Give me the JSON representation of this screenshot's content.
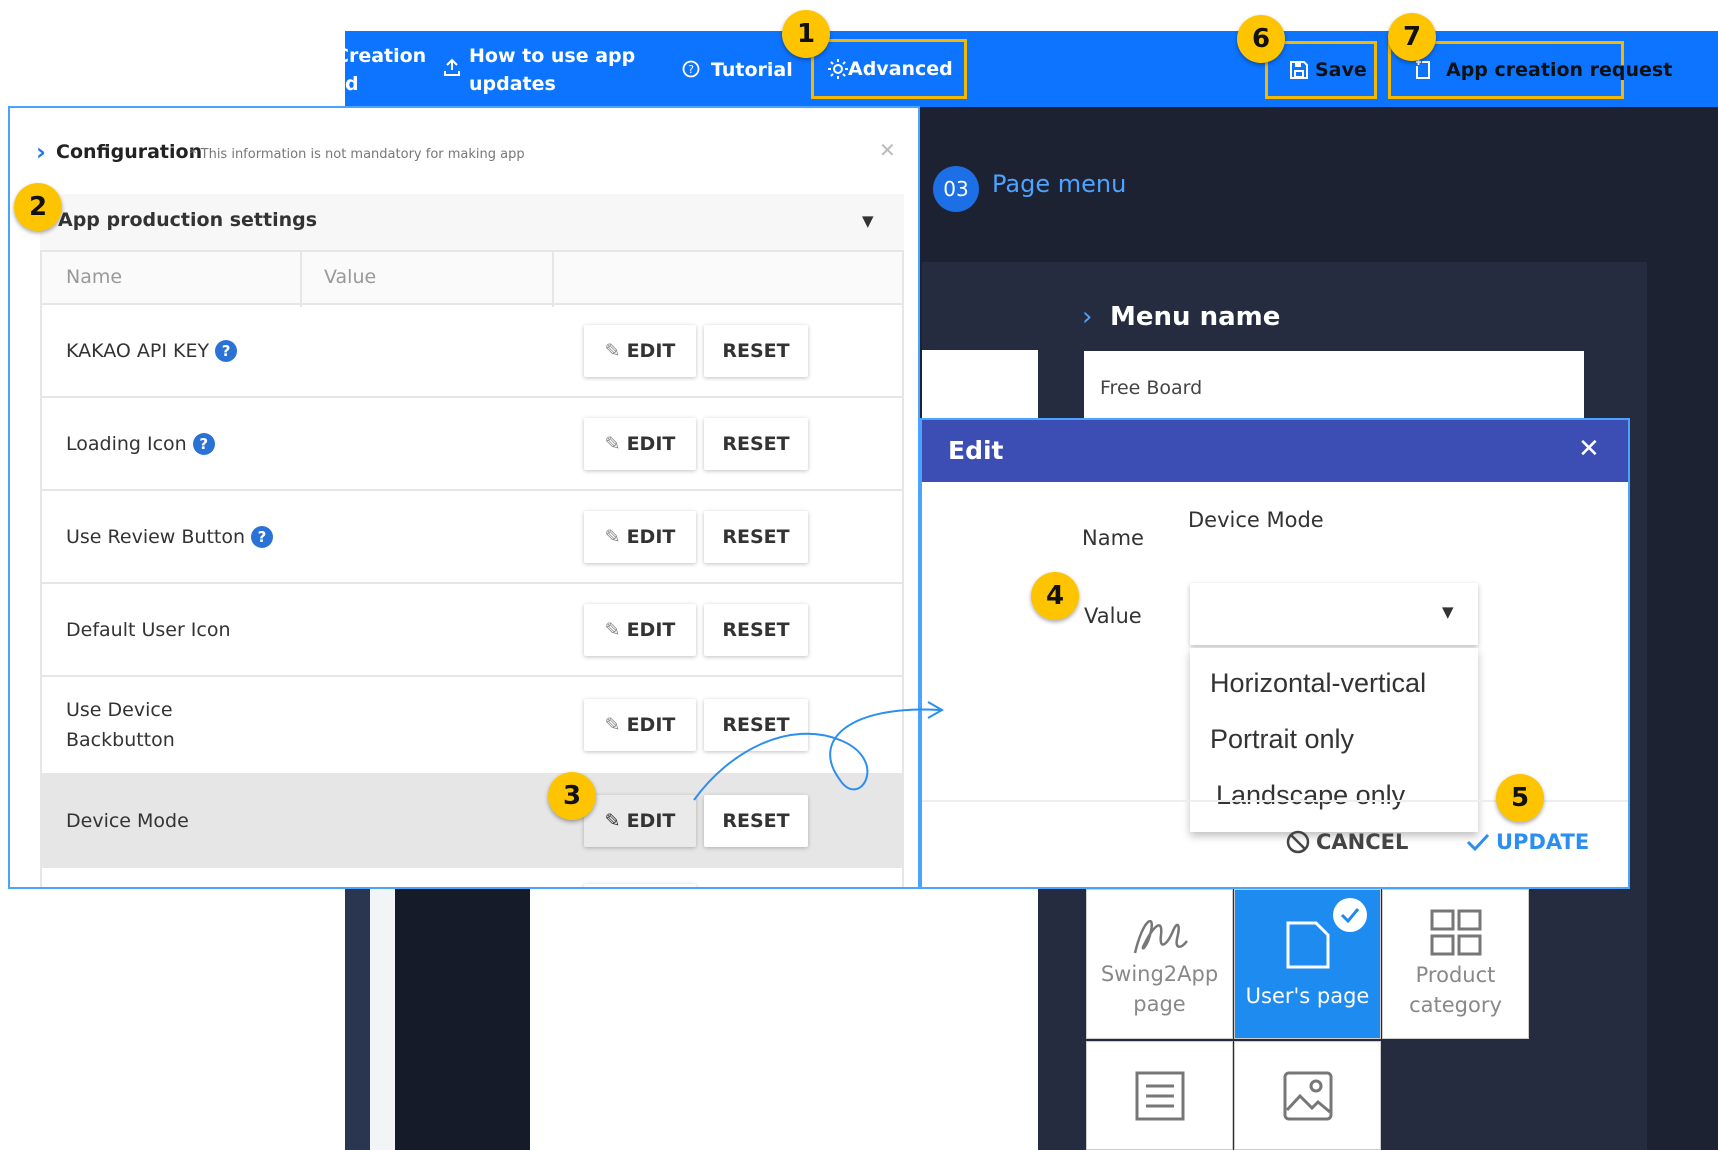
{
  "topbar": {
    "creation_line1": "Creation",
    "creation_line2": "d",
    "how_to_line1": "How to use app",
    "how_to_line2": "updates",
    "tutorial_label": "Tutorial",
    "advanced_label": "Advanced",
    "save_label": "Save",
    "app_creation_request_label": "App creation request"
  },
  "background": {
    "page_menu_number": "03",
    "page_menu_title": "Page menu",
    "menu_name_label": "Menu name",
    "menu_name_value": "Free Board",
    "tiles": [
      {
        "label": "Swing2App page",
        "line1": "Swing2App",
        "line2": "page"
      },
      {
        "label": "User's page",
        "line1": "User's page",
        "line2": ""
      },
      {
        "label": "Product category",
        "line1": "Product",
        "line2": "category"
      }
    ]
  },
  "config": {
    "title": "Configuration",
    "note": "* This information is not mandatory for making app",
    "section_title": "App production settings",
    "headers": [
      "Name",
      "Value",
      ""
    ],
    "rows": [
      {
        "name": "KAKAO API KEY",
        "help": true
      },
      {
        "name": "Loading Icon",
        "help": true
      },
      {
        "name": "Use Review Button",
        "help": true
      },
      {
        "name": "Default User Icon",
        "help": false
      },
      {
        "name_line1": "Use Device",
        "name_line2": "Backbutton",
        "help": false
      },
      {
        "name": "Device Mode",
        "help": false,
        "active": true
      }
    ],
    "edit_label": "EDIT",
    "reset_label": "RESET"
  },
  "edit_dialog": {
    "title": "Edit",
    "name_label": "Name",
    "name_value": "Device Mode",
    "value_label": "Value",
    "options": [
      "Horizontal-vertical",
      "Portrait only",
      "Landscape only"
    ],
    "cancel_label": "CANCEL",
    "update_label": "UPDATE"
  },
  "badges": [
    "1",
    "2",
    "3",
    "4",
    "5",
    "6",
    "7"
  ],
  "colors": {
    "topbar": "#0d74ff",
    "highlight": "#f5b800",
    "badge": "#ffc400",
    "dialog_header": "#3c4eb4",
    "update": "#2b8ef0",
    "dark_bg": "#1d2233"
  }
}
